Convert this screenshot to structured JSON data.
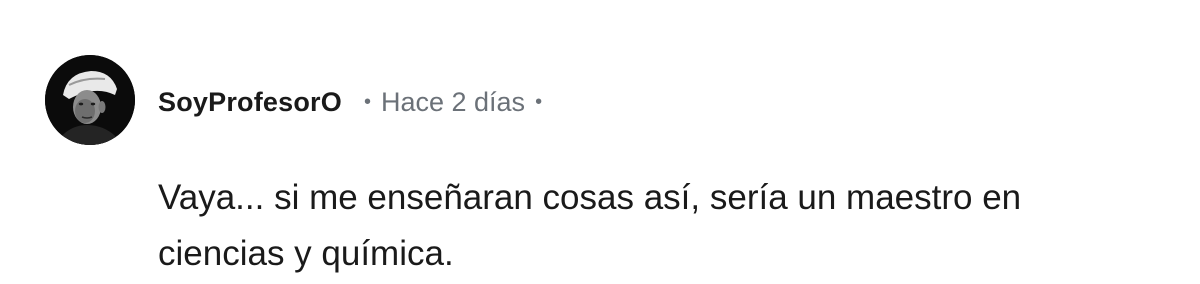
{
  "comment": {
    "author": "SoyProfesorO",
    "separator": "•",
    "timestamp": "Hace 2 días",
    "text": "Vaya... si me enseñaran cosas así, sería un maestro en ciencias y química.",
    "avatar_icon": "user-avatar-photo"
  },
  "colors": {
    "author": "#1a1a1a",
    "meta": "#6b7178",
    "body": "#1a1a1a",
    "background": "#ffffff"
  }
}
